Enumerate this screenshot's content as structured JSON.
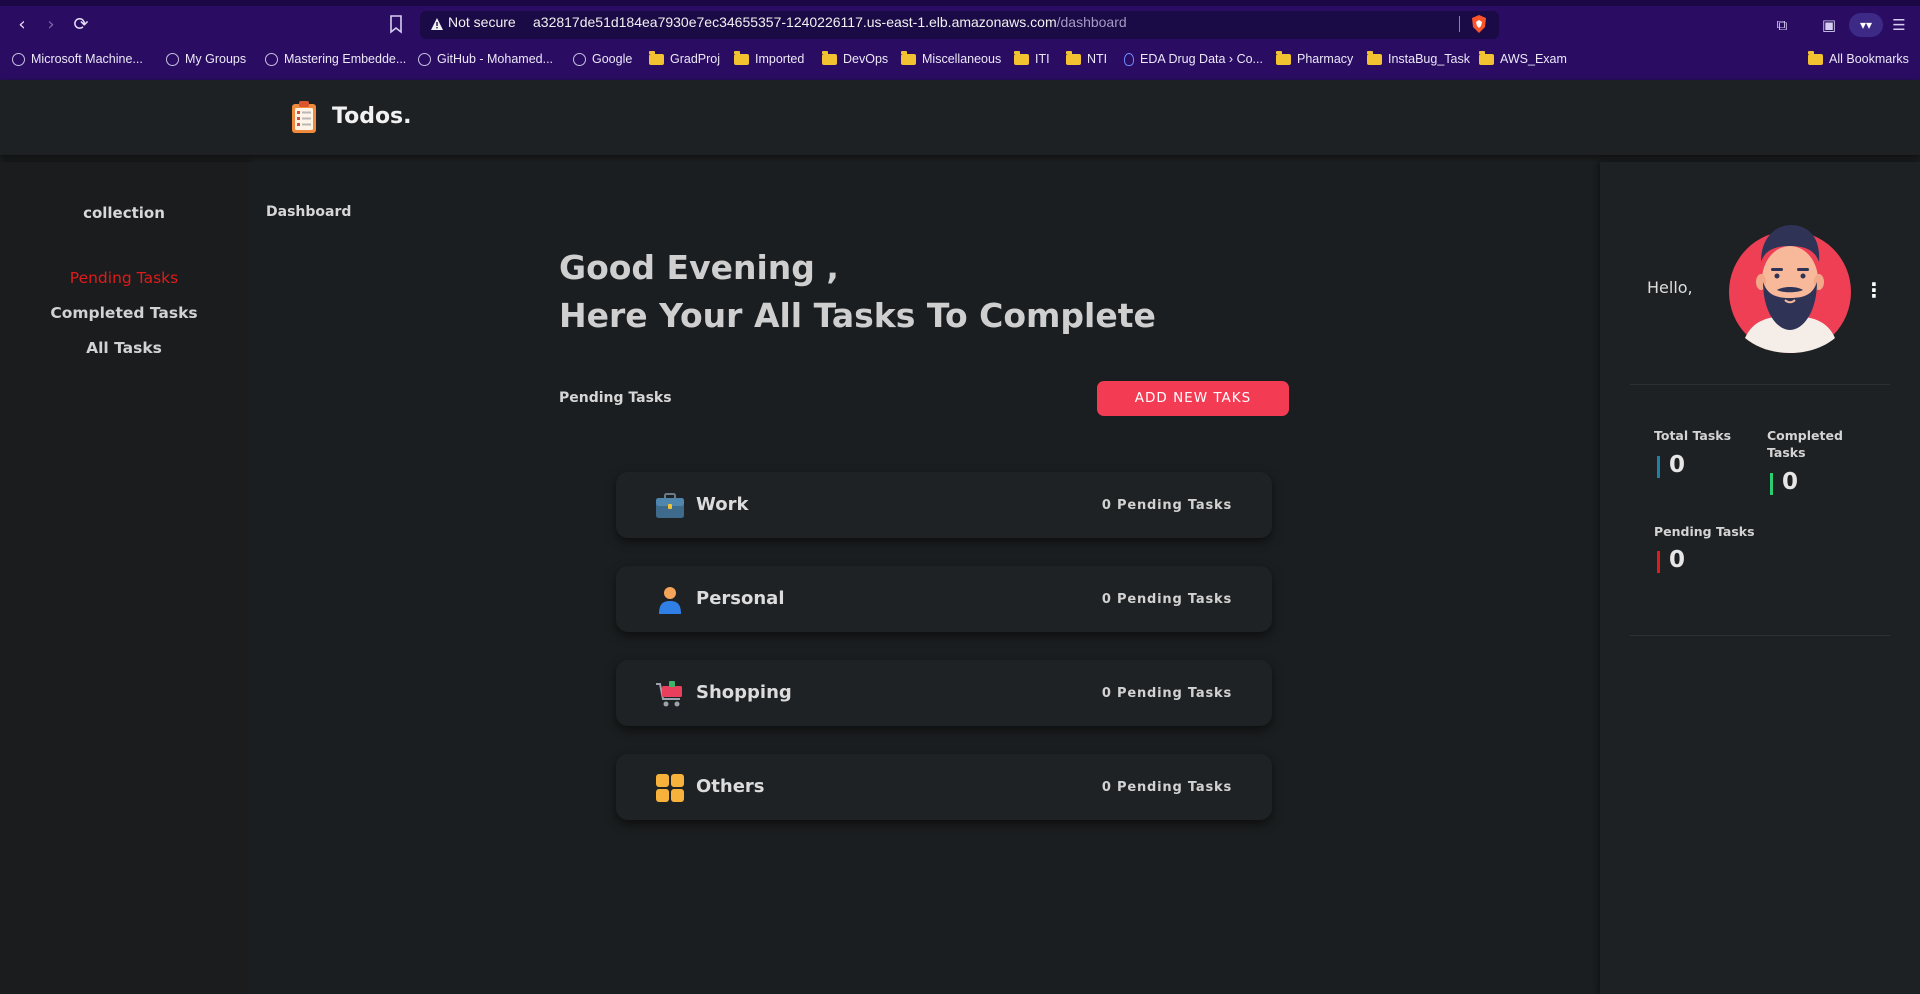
{
  "browser": {
    "url_status": "Not secure",
    "url_host": "a32817de51d184ea7930e7ec34655357-1240226117.us-east-1.elb.amazonaws.com",
    "url_path": "/dashboard",
    "profile_label": "▾▾",
    "bookmarks": [
      {
        "label": "Microsoft Machine...",
        "icon": "globe-icon"
      },
      {
        "label": "My Groups",
        "icon": "globe-icon"
      },
      {
        "label": "Mastering Embedde...",
        "icon": "globe-icon"
      },
      {
        "label": "GitHub - Mohamed...",
        "icon": "globe-icon"
      },
      {
        "label": "Google",
        "icon": "globe-icon"
      },
      {
        "label": "GradProj",
        "icon": "folder-icon"
      },
      {
        "label": "Imported",
        "icon": "folder-icon"
      },
      {
        "label": "DevOps",
        "icon": "folder-icon"
      },
      {
        "label": "Miscellaneous",
        "icon": "folder-icon"
      },
      {
        "label": "ITI",
        "icon": "folder-icon"
      },
      {
        "label": "NTI",
        "icon": "folder-icon"
      },
      {
        "label": "EDA Drug Data › Co...",
        "icon": "drug-icon"
      },
      {
        "label": "Pharmacy",
        "icon": "folder-icon"
      },
      {
        "label": "InstaBug_Task",
        "icon": "folder-icon"
      },
      {
        "label": "AWS_Exam",
        "icon": "folder-icon"
      }
    ],
    "all_bookmarks": "All Bookmarks"
  },
  "app": {
    "logo_text": "Todos.",
    "sidebar": {
      "title": "collection",
      "links": [
        "Pending Tasks",
        "Completed Tasks",
        "All Tasks"
      ]
    },
    "breadcrumb": "Dashboard",
    "greeting_line1": "Good Evening ,",
    "greeting_line2": "Here Your All Tasks To Complete",
    "section_label": "Pending Tasks",
    "add_button": "ADD NEW TAKS",
    "categories": [
      {
        "title": "Work",
        "count": "0 Pending Tasks",
        "icon": "briefcase-icon"
      },
      {
        "title": "Personal",
        "count": "0 Pending Tasks",
        "icon": "person-icon"
      },
      {
        "title": "Shopping",
        "count": "0 Pending Tasks",
        "icon": "cart-icon"
      },
      {
        "title": "Others",
        "count": "0 Pending Tasks",
        "icon": "grid-icon"
      }
    ],
    "profile": {
      "hello": "Hello,",
      "kebab": "⋮",
      "stats": [
        {
          "label": "Total Tasks",
          "value": "0",
          "color": "#1e7fa8"
        },
        {
          "label": "Completed Tasks",
          "value": "0",
          "color": "#2ecc71"
        },
        {
          "label": "Pending Tasks",
          "value": "0",
          "color": "#e01b1b"
        }
      ]
    }
  },
  "colors": {
    "accent": "#f43b54",
    "active_link": "#e01b1b",
    "chrome": "#2a0d63"
  }
}
